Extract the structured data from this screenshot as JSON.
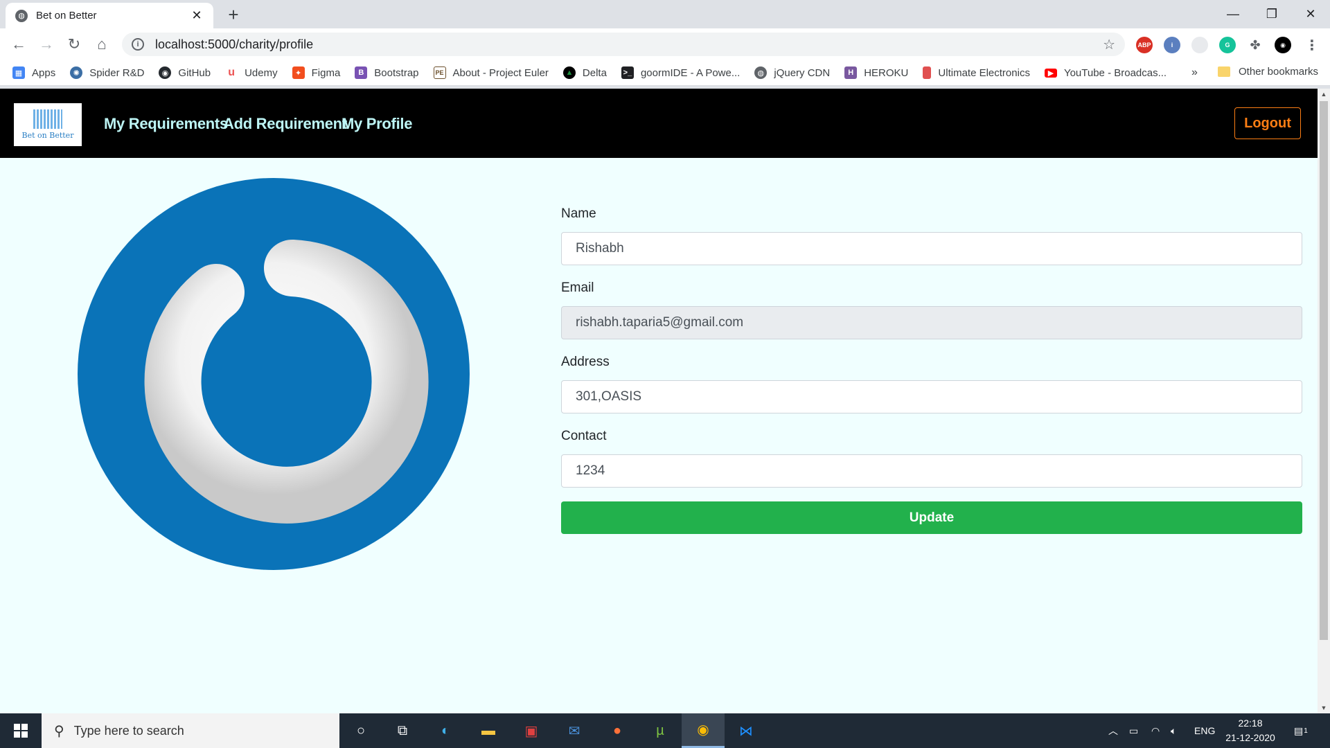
{
  "browser": {
    "tab_title": "Bet on Better",
    "new_tab": "+",
    "close_tab": "✕",
    "url": "localhost:5000/charity/profile",
    "window_controls": {
      "minimize": "—",
      "restore": "❐",
      "close": "✕"
    }
  },
  "bookmarks": {
    "items": [
      {
        "label": "Apps",
        "icon": "apps-grid-icon",
        "color": "#4285f4"
      },
      {
        "label": "Spider R&D",
        "icon": "spider-icon",
        "color": "#3b6ea5"
      },
      {
        "label": "GitHub",
        "icon": "github-icon",
        "color": "#24292e"
      },
      {
        "label": "Udemy",
        "icon": "udemy-icon",
        "color": "#ec5252"
      },
      {
        "label": "Figma",
        "icon": "figma-icon",
        "color": "#f24e1e"
      },
      {
        "label": "Bootstrap",
        "icon": "bootstrap-icon",
        "color": "#7952b3"
      },
      {
        "label": "About - Project Euler",
        "icon": "euler-icon",
        "color": "#6b4f2b"
      },
      {
        "label": "Delta",
        "icon": "delta-icon",
        "color": "#1e8e3e"
      },
      {
        "label": "goormIDE - A Powe...",
        "icon": "terminal-icon",
        "color": "#202124"
      },
      {
        "label": "jQuery CDN",
        "icon": "globe-icon",
        "color": "#5f6368"
      },
      {
        "label": "HEROKU",
        "icon": "heroku-icon",
        "color": "#79589f"
      },
      {
        "label": "Ultimate Electronics",
        "icon": "electronics-icon",
        "color": "#e05050"
      },
      {
        "label": "YouTube - Broadcas...",
        "icon": "youtube-icon",
        "color": "#ff0000"
      }
    ],
    "more": "»",
    "other": "Other bookmarks"
  },
  "navbar": {
    "logo_text": "Bet on Better",
    "links": [
      "My Requirements",
      "Add Requirement",
      "My Profile"
    ],
    "logout": "Logout"
  },
  "profile": {
    "name_label": "Name",
    "name_value": "Rishabh",
    "email_label": "Email",
    "email_value": "rishabh.taparia5@gmail.com",
    "address_label": "Address",
    "address_value": "301,OASIS",
    "contact_label": "Contact",
    "contact_value": "1234",
    "update_label": "Update"
  },
  "taskbar": {
    "search_placeholder": "Type here to search",
    "language": "ENG",
    "time": "22:18",
    "date": "21-12-2020",
    "notification_count": "1"
  }
}
